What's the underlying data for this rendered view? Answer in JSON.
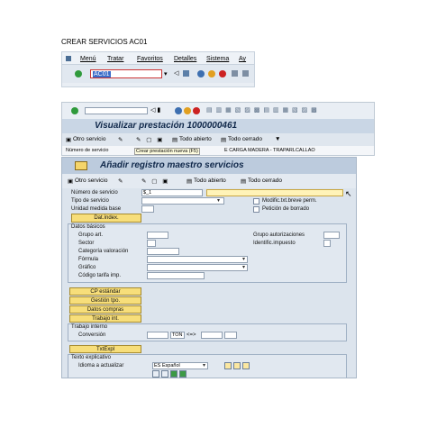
{
  "doc": {
    "title": "CREAR SERVICIOS AC01"
  },
  "shot1": {
    "menu": [
      "Menú",
      "Tratar",
      "Favoritos",
      "Detalles",
      "Sistema",
      "Ay"
    ],
    "command_value": "AC01"
  },
  "shot2": {
    "title": "Visualizar prestación 1000000461",
    "toolbar": {
      "otro_servicio": "Otro servicio",
      "todo_abierto": "Todo abierto",
      "todo_cerrado": "Todo cerrado"
    },
    "row": {
      "numero_servicio": "Número de servicio",
      "crear_nueva": "Crear prestación nueva  (F5)",
      "carga": "E CARGA MADERA - TRAPARLCALLAO"
    }
  },
  "dialog": {
    "title": "Añadir registro maestro servicios",
    "toolbar": {
      "otro_servicio": "Otro servicio",
      "todo_abierto": "Todo abierto",
      "todo_cerrado": "Todo cerrado"
    },
    "numero_servicio_label": "Número de servicio",
    "numero_servicio_value": "$_1",
    "tipo_servicio_label": "Tipo de servicio",
    "unidad_medida_label": "Unidad medida base",
    "modif_label": "Modific.txt.breve perm.",
    "peticion_label": "Petición de borrado",
    "dat_index_label": "Dat.índex.",
    "datos_basicos": {
      "header": "Datos básicos",
      "grupo_art": "Grupo art.",
      "sector": "Sector",
      "categoria": "Categoría valoración",
      "formula": "Fórmula",
      "grafico": "Gráfico",
      "codigo_tarifa": "Código tarifa imp.",
      "grupo_autorizaciones": "Grupo autorizaciones",
      "identific": "Identific.impuesto"
    },
    "buttons": {
      "cp_estandar": "CP estándar",
      "gestion_tpo": "Gestión tpo.",
      "datos_compras": "Datos compras",
      "trabajo_int": "Trabajo int."
    },
    "trabajo_interno": {
      "header": "Trabajo interno",
      "conversion": "Conversión",
      "ton": "TON",
      "arrow": "<=>"
    },
    "txtexpl_button": "TxtExpl",
    "texto_explicativo": {
      "header": "Texto explicativo",
      "idioma_label": "Idioma a actualizar",
      "idioma_value": "ES Español"
    }
  }
}
